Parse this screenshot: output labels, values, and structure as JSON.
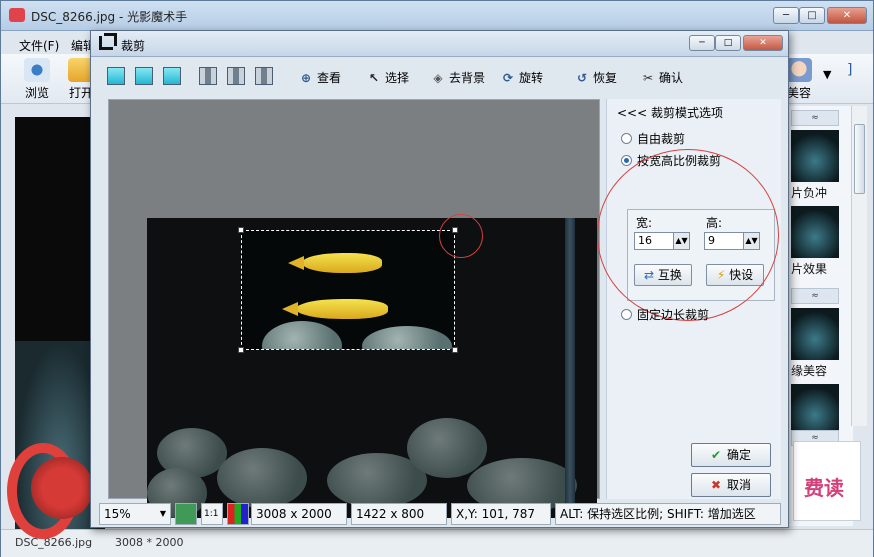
{
  "main_window": {
    "title": "DSC_8266.jpg - 光影魔术手",
    "min_label": "─",
    "max_label": "□",
    "close_label": "✕",
    "menu": [
      "文件(F)",
      "编辑"
    ],
    "toolbar": [
      {
        "label": "浏览",
        "icon": "eye-icon"
      },
      {
        "label": "打开",
        "icon": "folder-icon"
      }
    ],
    "right_toolbar": [
      {
        "label": "美容",
        "icon": "face-icon"
      },
      {
        "label": "▼"
      },
      {
        "label": "]"
      }
    ],
    "thumbnails": [
      {
        "label": "片负冲"
      },
      {
        "label": "片效果"
      },
      {
        "label": "缘美容"
      },
      {
        "label": ""
      }
    ],
    "scroll_up": "≈",
    "status_left": "DSC_8266.jpg",
    "status_size": "3008 * 2000",
    "ad_text": "费读"
  },
  "crop_dialog": {
    "title": "裁剪",
    "min_label": "─",
    "max_label": "□",
    "close_label": "✕",
    "toolbar": [
      {
        "label": "查看",
        "icon": "magnify-icon"
      },
      {
        "label": "选择",
        "icon": "cursor-icon"
      },
      {
        "label": "去背景",
        "icon": "background-icon"
      },
      {
        "label": "旋转",
        "icon": "rotate-icon"
      },
      {
        "label": "恢复",
        "icon": "undo-icon"
      },
      {
        "label": "确认",
        "icon": "scissors-icon"
      }
    ],
    "options": {
      "header": "<<< 裁剪模式选项",
      "mode_free": "自由裁剪",
      "mode_ratio": "按宽高比例裁剪",
      "mode_fixed": "固定边长裁剪",
      "selected_mode": "ratio",
      "width_label": "宽:",
      "height_label": "高:",
      "width_value": "16",
      "height_value": "9",
      "swap_label": "互换",
      "quickset_label": "快设"
    },
    "confirm_label": "确定",
    "cancel_label": "取消",
    "status": {
      "zoom": "15%",
      "one_to_one": "1:1",
      "image_size": "3008 x 2000",
      "selection_size": "1422 x 800",
      "coords": "X,Y: 101, 787",
      "hint": "ALT: 保持选区比例;  SHIFT: 增加选区"
    }
  },
  "accent_colors": {
    "ok": "#1e9b2a",
    "cancel": "#c8382b",
    "annotation": "#d84040"
  }
}
